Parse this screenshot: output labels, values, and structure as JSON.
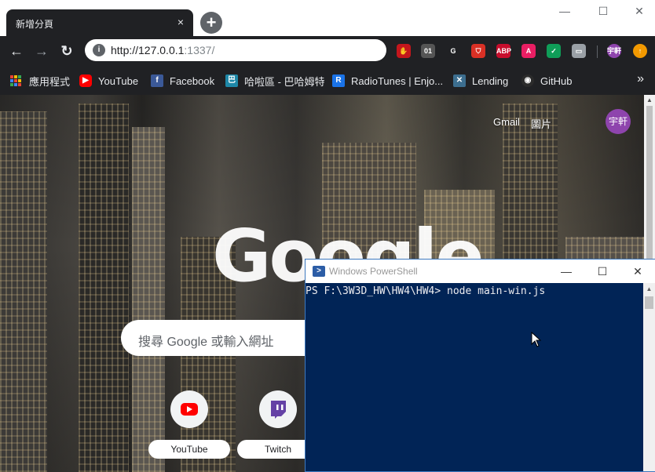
{
  "browser": {
    "tab_title": "新增分頁",
    "tab_close_glyph": "×",
    "newtab_glyph": "+",
    "window_controls": {
      "minimize": "—",
      "maximize": "☐",
      "close": "✕"
    },
    "nav": {
      "back": "←",
      "forward": "→",
      "reload": "↻"
    },
    "omnibox": {
      "host": "http://127.0.0.1",
      "port_path": ":1337/"
    },
    "extensions": [
      {
        "name": "ublock-icon",
        "label": "✋",
        "color": "#c4161c"
      },
      {
        "name": "binary-icon",
        "label": "01",
        "color": "#555555"
      },
      {
        "name": "google-icon",
        "label": "G",
        "color": "#202124"
      },
      {
        "name": "shield-icon",
        "label": "⛉",
        "color": "#d93025"
      },
      {
        "name": "adblock-plus-icon",
        "label": "ABP",
        "color": "#c70d2c"
      },
      {
        "name": "arc-icon",
        "label": "A",
        "color": "#e91e63"
      },
      {
        "name": "privacy-badge-icon",
        "label": "✓",
        "color": "#0f9d58"
      },
      {
        "name": "line-icon",
        "label": "▭",
        "color": "#9aa0a6"
      },
      {
        "name": "profile-avatar-icon",
        "label": "宇軒",
        "color": "#8e44ad"
      },
      {
        "name": "update-icon",
        "label": "↑",
        "color": "#f29900"
      }
    ],
    "bookmarks": [
      {
        "name": "bookmark-apps",
        "label": "應用程式"
      },
      {
        "name": "bookmark-youtube",
        "label": "YouTube"
      },
      {
        "name": "bookmark-facebook",
        "label": "Facebook"
      },
      {
        "name": "bookmark-bahamut",
        "label": "哈啦區 - 巴哈姆特"
      },
      {
        "name": "bookmark-radiotunes",
        "label": "RadioTunes | Enjo..."
      },
      {
        "name": "bookmark-lending",
        "label": "Lending"
      },
      {
        "name": "bookmark-github",
        "label": "GitHub"
      }
    ],
    "bookmarks_more": "»"
  },
  "newtab": {
    "links": {
      "gmail": "Gmail",
      "images": "圖片"
    },
    "avatar": "宇軒",
    "logo": "Google",
    "search_placeholder": "搜尋 Google 或輸入網址",
    "tiles": [
      {
        "name": "shortcut-youtube",
        "label": "YouTube"
      },
      {
        "name": "shortcut-twitch",
        "label": "Twitch"
      }
    ]
  },
  "powershell": {
    "title": "Windows PowerShell",
    "controls": {
      "minimize": "—",
      "maximize": "☐",
      "close": "✕"
    },
    "prompt_line": "PS F:\\3W3D_HW\\HW4\\HW4> node main-win.js"
  }
}
